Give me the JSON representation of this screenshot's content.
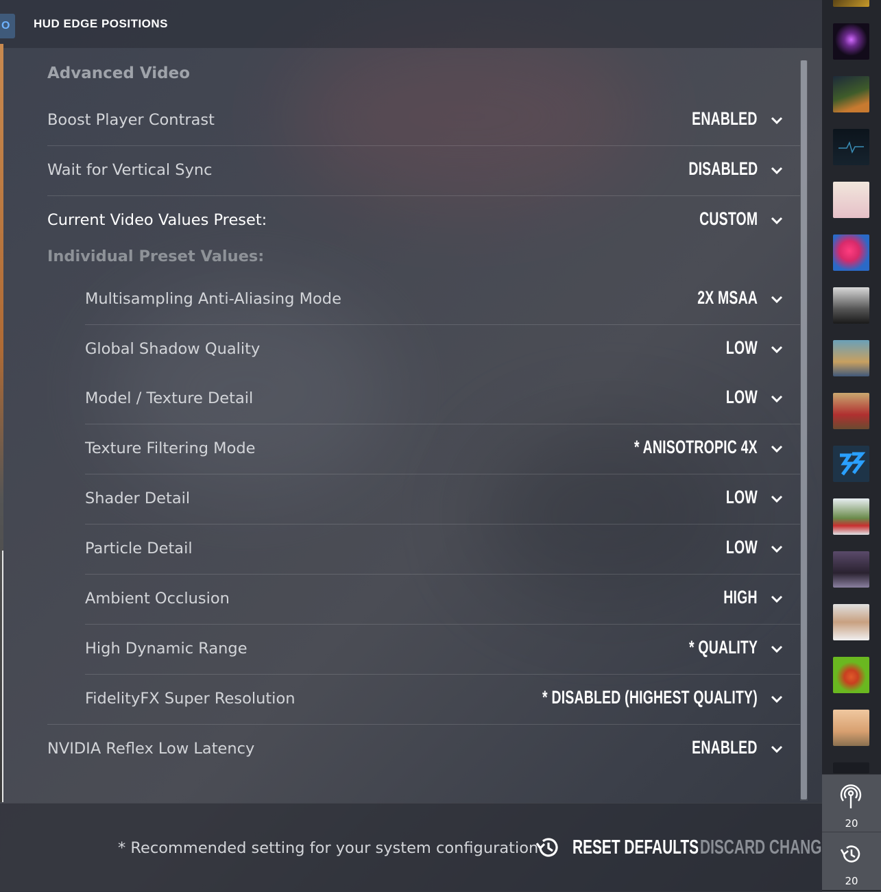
{
  "header": {
    "active_tab_label": "O",
    "tab_label": "HUD EDGE POSITIONS"
  },
  "section": {
    "title": "Advanced Video",
    "subheading": "Individual Preset Values:"
  },
  "settings": [
    {
      "label": "Boost Player Contrast",
      "value": "ENABLED"
    },
    {
      "label": "Wait for Vertical Sync",
      "value": "DISABLED"
    },
    {
      "label": "Current Video Values Preset:",
      "value": "CUSTOM"
    }
  ],
  "preset_values": [
    {
      "label": "Multisampling Anti-Aliasing Mode",
      "value": "2X MSAA"
    },
    {
      "label": "Global Shadow Quality",
      "value": "LOW"
    },
    {
      "label": "Model / Texture Detail",
      "value": "LOW"
    },
    {
      "label": "Texture Filtering Mode",
      "value": "* ANISOTROPIC 4X"
    },
    {
      "label": "Shader Detail",
      "value": "LOW"
    },
    {
      "label": "Particle Detail",
      "value": "LOW"
    },
    {
      "label": "Ambient Occlusion",
      "value": "HIGH"
    },
    {
      "label": "High Dynamic Range",
      "value": "* QUALITY"
    },
    {
      "label": "FidelityFX Super Resolution",
      "value": "* DISABLED (HIGHEST QUALITY)"
    }
  ],
  "reflex": {
    "label": "NVIDIA Reflex Low Latency",
    "value": "ENABLED"
  },
  "footer": {
    "note": "* Recommended setting for your system configuration",
    "reset_label": "RESET DEFAULTS",
    "discard_label": "DISCARD CHANGES"
  },
  "sidebar": {
    "friends_icons": [
      "avatar-1",
      "avatar-2",
      "avatar-3",
      "avatar-4",
      "avatar-5",
      "avatar-6",
      "avatar-7",
      "avatar-8",
      "avatar-9",
      "avatar-10",
      "avatar-11",
      "avatar-12",
      "avatar-13",
      "avatar-14"
    ],
    "broadcast_count": "20",
    "recent_count": "20"
  },
  "colors": {
    "accent": "#6fb3ff",
    "text": "#ffffff",
    "muted": "#8b8f96"
  }
}
